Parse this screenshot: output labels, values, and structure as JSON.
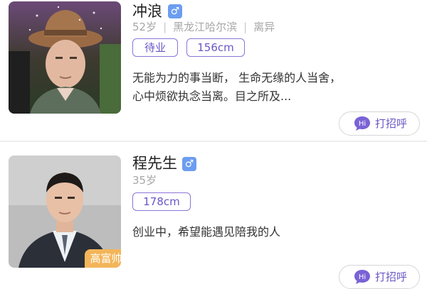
{
  "profiles": [
    {
      "name": "冲浪",
      "gender_symbol": "♂",
      "age": "52岁",
      "location": "黑龙江哈尔滨",
      "marital": "离异",
      "tags": [
        "待业",
        "156cm"
      ],
      "description": "无能为力的事当断， 生命无缘的人当舍，心中烦欲执念当离。目之所及...",
      "greet_badge": "Hi",
      "greet_label": "打招呼"
    },
    {
      "name": "程先生",
      "gender_symbol": "♂",
      "age": "35岁",
      "tags": [
        "178cm"
      ],
      "photo_tag": "高富帅",
      "description": "创业中，希望能遇见陪我的人",
      "greet_badge": "Hi",
      "greet_label": "打招呼"
    }
  ],
  "colors": {
    "accent": "#6a56c6",
    "gender_badge": "#6c9df0",
    "photo_tag": "#f3b559",
    "meta_gray": "#a6a6a6"
  }
}
